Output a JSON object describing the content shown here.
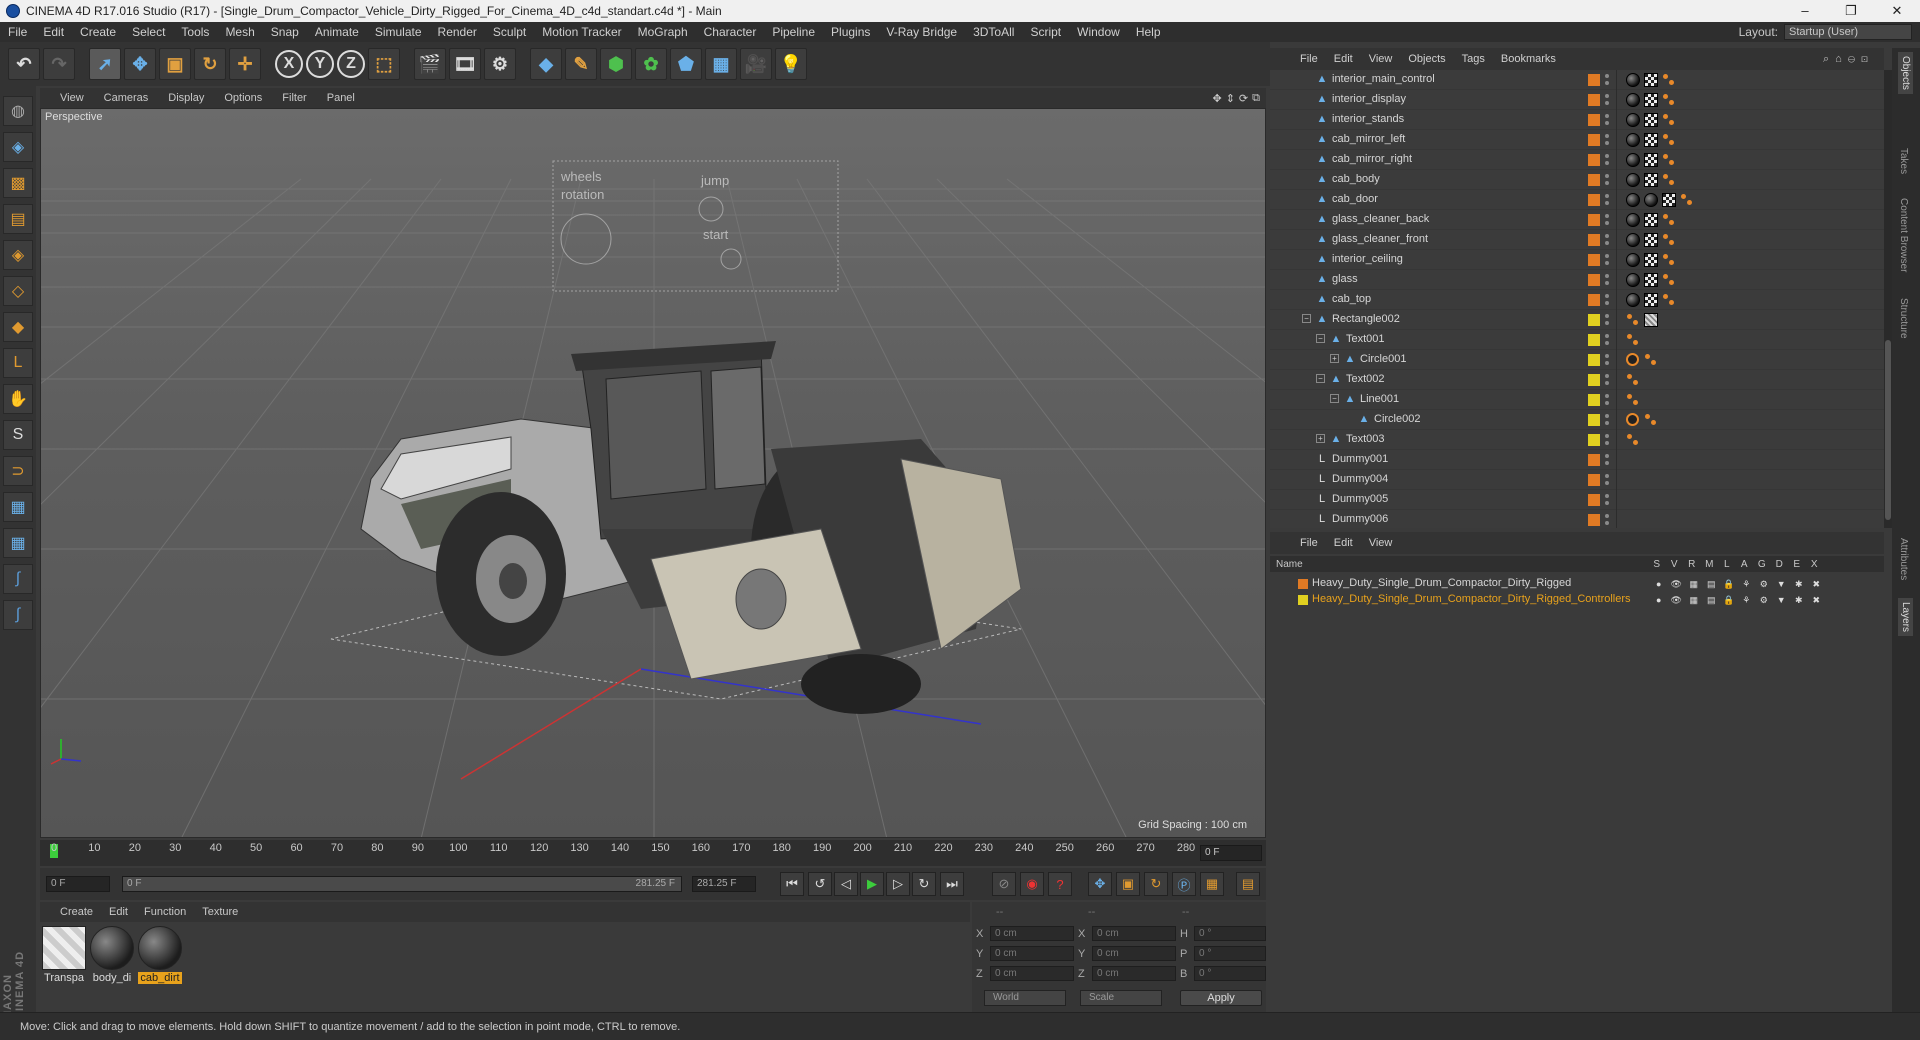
{
  "window": {
    "title": "CINEMA 4D R17.016 Studio (R17) - [Single_Drum_Compactor_Vehicle_Dirty_Rigged_For_Cinema_4D_c4d_standart.c4d *] - Main",
    "minimize": "–",
    "maximize": "❐",
    "close": "✕"
  },
  "menubar": {
    "items": [
      "File",
      "Edit",
      "Create",
      "Select",
      "Tools",
      "Mesh",
      "Snap",
      "Animate",
      "Simulate",
      "Render",
      "Sculpt",
      "Motion Tracker",
      "MoGraph",
      "Character",
      "Pipeline",
      "Plugins",
      "V-Ray Bridge",
      "3DToAll",
      "Script",
      "Window",
      "Help"
    ],
    "layout_label": "Layout:",
    "layout_value": "Startup (User)"
  },
  "viewport": {
    "menu": [
      "View",
      "Cameras",
      "Display",
      "Options",
      "Filter",
      "Panel"
    ],
    "camera_label": "Perspective",
    "grid_spacing": "Grid Spacing : 100 cm",
    "overlay_text": [
      "wheels",
      "rotation",
      "jump",
      "start"
    ]
  },
  "timeline": {
    "ticks": [
      "0",
      "10",
      "20",
      "30",
      "40",
      "50",
      "60",
      "70",
      "80",
      "90",
      "100",
      "110",
      "120",
      "130",
      "140",
      "150",
      "160",
      "170",
      "180",
      "190",
      "200",
      "210",
      "220",
      "230",
      "240",
      "250",
      "260",
      "270",
      "280"
    ],
    "current_frame_display": "0 F"
  },
  "transport": {
    "start_frame": "0 F",
    "range_start": "0 F",
    "range_end": "281.25 F",
    "end_frame": "281.25 F"
  },
  "material_manager": {
    "menu": [
      "Create",
      "Edit",
      "Function",
      "Texture"
    ],
    "materials": [
      {
        "label": "Transpa",
        "kind": "transparent",
        "selected": false
      },
      {
        "label": "body_di",
        "kind": "sphere",
        "selected": false
      },
      {
        "label": "cab_dirt",
        "kind": "sphere",
        "selected": true
      }
    ]
  },
  "coordinates": {
    "headers": [
      "--",
      "--",
      "--"
    ],
    "rows": [
      {
        "a": "X",
        "av": "0 cm",
        "b": "X",
        "bv": "0 cm",
        "c": "H",
        "cv": "0 °"
      },
      {
        "a": "Y",
        "av": "0 cm",
        "b": "Y",
        "bv": "0 cm",
        "c": "P",
        "cv": "0 °"
      },
      {
        "a": "Z",
        "av": "0 cm",
        "b": "Z",
        "bv": "0 cm",
        "c": "B",
        "cv": "0 °"
      }
    ],
    "world": "World",
    "scale": "Scale",
    "apply": "Apply"
  },
  "status": "Move: Click and drag to move elements. Hold down SHIFT to quantize movement / add to the selection in point mode, CTRL to remove.",
  "object_manager": {
    "menu": [
      "File",
      "Edit",
      "View",
      "Objects",
      "Tags",
      "Bookmarks"
    ],
    "objects": [
      {
        "name": "interior_main_control",
        "indent": 0,
        "icon": "polygon",
        "color": "#e07a24",
        "tags": [
          "ball",
          "check",
          "phong"
        ]
      },
      {
        "name": "interior_display",
        "indent": 0,
        "icon": "polygon",
        "color": "#e07a24",
        "tags": [
          "ball",
          "check",
          "phong"
        ]
      },
      {
        "name": "interior_stands",
        "indent": 0,
        "icon": "polygon",
        "color": "#e07a24",
        "tags": [
          "ball",
          "check",
          "phong"
        ]
      },
      {
        "name": "cab_mirror_left",
        "indent": 0,
        "icon": "polygon",
        "color": "#e07a24",
        "tags": [
          "ball",
          "check",
          "phong"
        ]
      },
      {
        "name": "cab_mirror_right",
        "indent": 0,
        "icon": "polygon",
        "color": "#e07a24",
        "tags": [
          "ball",
          "check",
          "phong"
        ]
      },
      {
        "name": "cab_body",
        "indent": 0,
        "icon": "polygon",
        "color": "#e07a24",
        "tags": [
          "ball",
          "check",
          "phong"
        ]
      },
      {
        "name": "cab_door",
        "indent": 0,
        "icon": "polygon",
        "color": "#e07a24",
        "tags": [
          "ball",
          "ball",
          "check",
          "phong"
        ]
      },
      {
        "name": "glass_cleaner_back",
        "indent": 0,
        "icon": "polygon",
        "color": "#e07a24",
        "tags": [
          "ball",
          "check",
          "phong"
        ]
      },
      {
        "name": "glass_cleaner_front",
        "indent": 0,
        "icon": "polygon",
        "color": "#e07a24",
        "tags": [
          "ball",
          "check",
          "phong"
        ]
      },
      {
        "name": "interior_ceiling",
        "indent": 0,
        "icon": "polygon",
        "color": "#e07a24",
        "tags": [
          "ball",
          "check",
          "phong"
        ]
      },
      {
        "name": "glass",
        "indent": 0,
        "icon": "polygon",
        "color": "#e07a24",
        "tags": [
          "ball",
          "check",
          "phong"
        ]
      },
      {
        "name": "cab_top",
        "indent": 0,
        "icon": "polygon",
        "color": "#e07a24",
        "tags": [
          "ball",
          "check",
          "phong"
        ]
      },
      {
        "name": "Rectangle002",
        "indent": 0,
        "icon": "spline",
        "color": "#e0d020",
        "expand": "−",
        "tags": [
          "phong",
          "hatch"
        ]
      },
      {
        "name": "Text001",
        "indent": 1,
        "icon": "spline",
        "color": "#e0d020",
        "expand": "−",
        "tags": [
          "phong"
        ]
      },
      {
        "name": "Circle001",
        "indent": 2,
        "icon": "spline",
        "color": "#e0d020",
        "expand": "+",
        "tags": [
          "no",
          "phong"
        ]
      },
      {
        "name": "Text002",
        "indent": 1,
        "icon": "spline",
        "color": "#e0d020",
        "expand": "−",
        "tags": [
          "phong"
        ]
      },
      {
        "name": "Line001",
        "indent": 2,
        "icon": "spline",
        "color": "#e0d020",
        "expand": "−",
        "tags": [
          "phong"
        ]
      },
      {
        "name": "Circle002",
        "indent": 3,
        "icon": "spline",
        "color": "#e0d020",
        "tags": [
          "no",
          "phong"
        ]
      },
      {
        "name": "Text003",
        "indent": 1,
        "icon": "spline",
        "color": "#e0d020",
        "expand": "+",
        "tags": [
          "phong"
        ]
      },
      {
        "name": "Dummy001",
        "indent": 0,
        "icon": "null",
        "color": "#e07a24",
        "tags": []
      },
      {
        "name": "Dummy004",
        "indent": 0,
        "icon": "null",
        "color": "#e07a24",
        "tags": []
      },
      {
        "name": "Dummy005",
        "indent": 0,
        "icon": "null",
        "color": "#e07a24",
        "tags": []
      },
      {
        "name": "Dummy006",
        "indent": 0,
        "icon": "null",
        "color": "#e07a24",
        "tags": []
      }
    ]
  },
  "layer_manager": {
    "menu": [
      "File",
      "Edit",
      "View"
    ],
    "header_name": "Name",
    "columns": [
      "S",
      "V",
      "R",
      "M",
      "L",
      "A",
      "G",
      "D",
      "E",
      "X"
    ],
    "layers": [
      {
        "name": "Heavy_Duty_Single_Drum_Compactor_Dirty_Rigged",
        "color": "#e07a24",
        "text_color": "#d6d6d6"
      },
      {
        "name": "Heavy_Duty_Single_Drum_Compactor_Dirty_Rigged_Controllers",
        "color": "#e0d020",
        "text_color": "#e8a21c"
      }
    ]
  },
  "side_tabs": [
    "Objects",
    "Takes",
    "Content Browser",
    "Structure",
    "Attributes",
    "Layers"
  ]
}
